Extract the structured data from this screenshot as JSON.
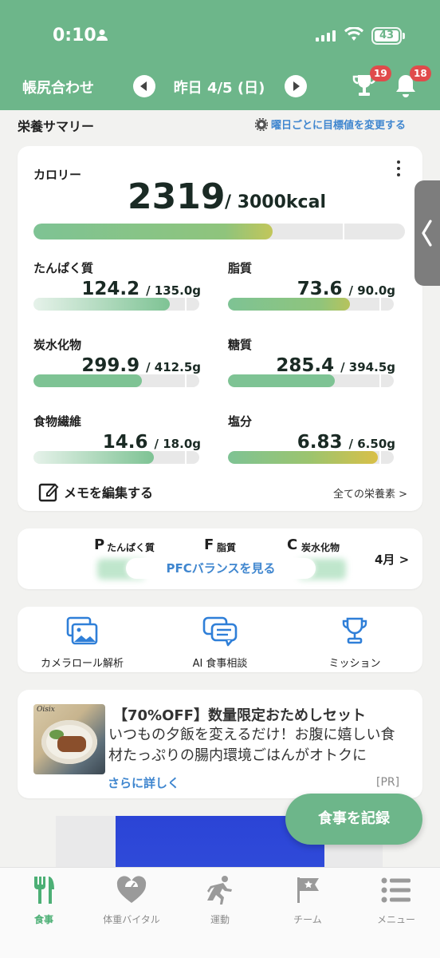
{
  "status_bar": {
    "time": "0:10",
    "battery": "43"
  },
  "header": {
    "left_title": "帳尻合わせ",
    "date": "昨日 4/5 (日)",
    "trophy_badge": "19",
    "bell_badge": "18"
  },
  "summary": {
    "title": "栄養サマリー",
    "change_target_link": "曜日ごとに目標値を変更する"
  },
  "calorie": {
    "label": "カロリー",
    "value": "2319",
    "target": "/ 3000kcal",
    "progress": 0.77
  },
  "nutrients": [
    {
      "name": "たんぱく質",
      "value": "124.2",
      "target": "/ 135.0g",
      "progress": 0.92,
      "color": "#7ec394"
    },
    {
      "name": "脂質",
      "value": "73.6",
      "target": "/ 90.0g",
      "progress": 0.82,
      "color": "#8cbf7a"
    },
    {
      "name": "炭水化物",
      "value": "299.9",
      "target": "/ 412.5g",
      "progress": 0.73,
      "color": "#7ec394"
    },
    {
      "name": "糖質",
      "value": "285.4",
      "target": "/ 394.5g",
      "progress": 0.72,
      "color": "#7ec394"
    },
    {
      "name": "食物繊維",
      "value": "14.6",
      "target": "/ 18.0g",
      "progress": 0.81,
      "color": "#7ec394"
    },
    {
      "name": "塩分",
      "value": "6.83",
      "target": "/ 6.50g",
      "progress": 1.05,
      "color": "#d9c048"
    }
  ],
  "card_footer": {
    "memo": "メモを編集する",
    "all_nutrients": "全ての栄養素 >"
  },
  "pfc": {
    "p_letter": "P",
    "p_name": "たんぱく質",
    "f_letter": "F",
    "f_name": "脂質",
    "c_letter": "C",
    "c_name": "炭水化物",
    "button": "PFCバランスを見る",
    "month_link": "4月 >"
  },
  "shortcuts": [
    {
      "label": "カメラロール解析",
      "icon": "photos-icon"
    },
    {
      "label": "AI 食事相談",
      "icon": "chat-icon"
    },
    {
      "label": "ミッション",
      "icon": "trophy-icon"
    }
  ],
  "ad": {
    "title": "【70%OFF】数量限定おためしセット",
    "body": "いつもの夕飯を変えるだけ！お腹に嬉しい食材たっぷりの腸内環境ごはんがオトクに",
    "more": "さらに詳しく",
    "pr": "[PR]",
    "image_logo": "Oisix"
  },
  "fab": {
    "label": "食事を記録"
  },
  "tabs": [
    {
      "label": "食事",
      "icon": "fork-knife-icon",
      "active": true
    },
    {
      "label": "体重バイタル",
      "icon": "scale-heart-icon",
      "active": false
    },
    {
      "label": "運動",
      "icon": "runner-icon",
      "active": false
    },
    {
      "label": "チーム",
      "icon": "flag-icon",
      "active": false
    },
    {
      "label": "メニュー",
      "icon": "menu-list-icon",
      "active": false
    }
  ],
  "colors": {
    "brand": "#6db68a",
    "link": "#3f86cf",
    "badge": "#e04b4b"
  }
}
